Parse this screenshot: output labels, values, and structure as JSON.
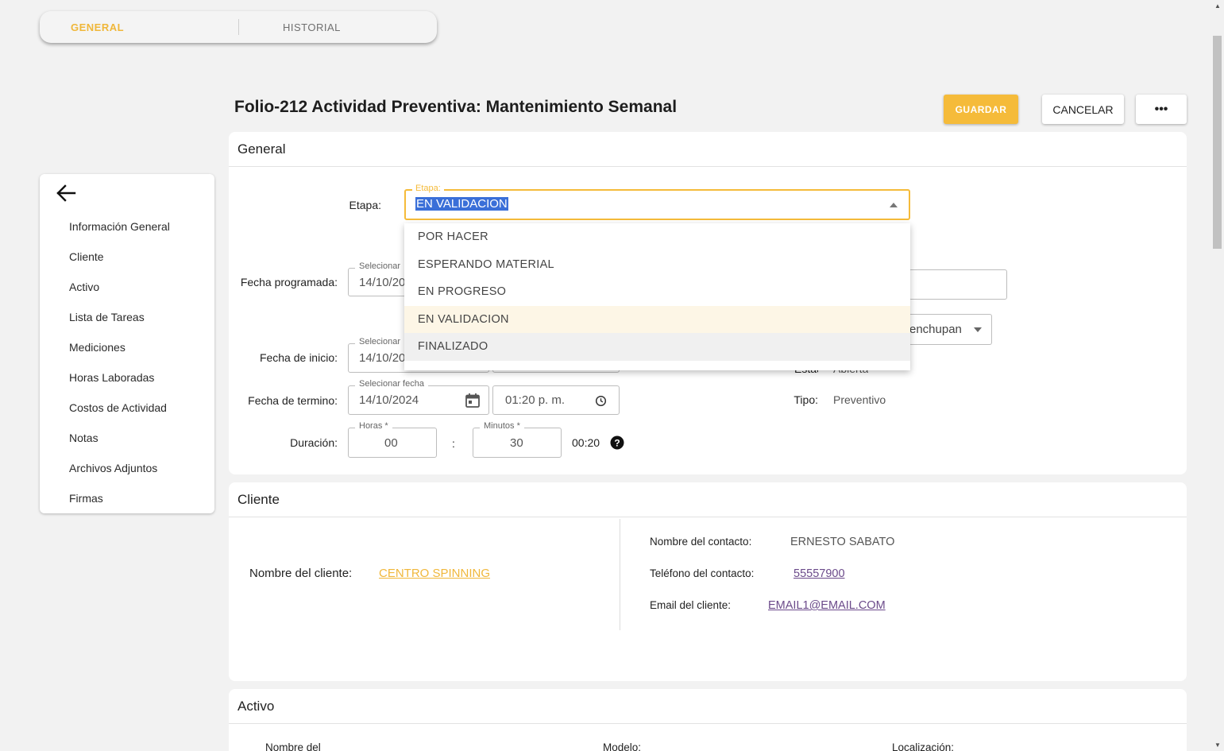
{
  "tabs": {
    "general": "GENERAL",
    "historial": "HISTORIAL"
  },
  "sidenav": {
    "items": [
      {
        "label": "Información General"
      },
      {
        "label": "Cliente"
      },
      {
        "label": "Activo"
      },
      {
        "label": "Lista de Tareas"
      },
      {
        "label": "Mediciones"
      },
      {
        "label": "Horas Laboradas"
      },
      {
        "label": "Costos de Actividad"
      },
      {
        "label": "Notas"
      },
      {
        "label": "Archivos Adjuntos"
      },
      {
        "label": "Firmas"
      }
    ]
  },
  "header": {
    "title": "Folio-212 Actividad Preventiva: Mantenimiento Semanal",
    "save_label": "GUARDAR",
    "cancel_label": "CANCELAR",
    "more_label": "•••"
  },
  "general": {
    "title": "General",
    "etapa_label": "Etapa:",
    "etapa_legend": "Etapa:",
    "etapa_value": "EN VALIDACION",
    "etapa_options": [
      "POR HACER",
      "ESPERANDO MATERIAL",
      "EN PROGRESO",
      "EN VALIDACION",
      "FINALIZADO"
    ],
    "fecha_programada_label": "Fecha programada:",
    "fecha_programada_legend": "Selecionar",
    "fecha_programada_value": "14/10/20",
    "fecha_inicio_label": "Fecha de inicio:",
    "fecha_inicio_legend": "Selecionar",
    "fecha_inicio_value": "14/10/20",
    "fecha_termino_label": "Fecha de termino:",
    "fecha_termino_legend": "Selecionar fecha",
    "fecha_termino_value": "14/10/2024",
    "hora_termino_value": "01:20 p. m.",
    "duracion_label": "Duración:",
    "horas_legend": "Horas *",
    "horas_value": "00",
    "minutos_legend": "Minutos *",
    "minutos_value": "30",
    "colon": ":",
    "duracion_total": "00:20",
    "responsable_partial": "enchupan",
    "estado_label": "Estado:",
    "estado_value": "Abierta",
    "tipo_label": "Tipo:",
    "tipo_value": "Preventivo"
  },
  "cliente": {
    "title": "Cliente",
    "nombre_label": "Nombre del cliente:",
    "nombre_value": "CENTRO SPINNING",
    "contacto_label": "Nombre del contacto:",
    "contacto_value": "ERNESTO SABATO",
    "telefono_label": "Teléfono del contacto:",
    "telefono_value": "55557900",
    "email_label": "Email del cliente:",
    "email_value": "EMAIL1@EMAIL.COM"
  },
  "activo": {
    "title": "Activo",
    "nombre_label": "Nombre del",
    "modelo_label": "Modelo:",
    "localizacion_label": "Localización:"
  },
  "colors": {
    "accent": "#f5bb3a",
    "link_purple": "#6b4a8a",
    "selection": "#3a6fd8"
  }
}
